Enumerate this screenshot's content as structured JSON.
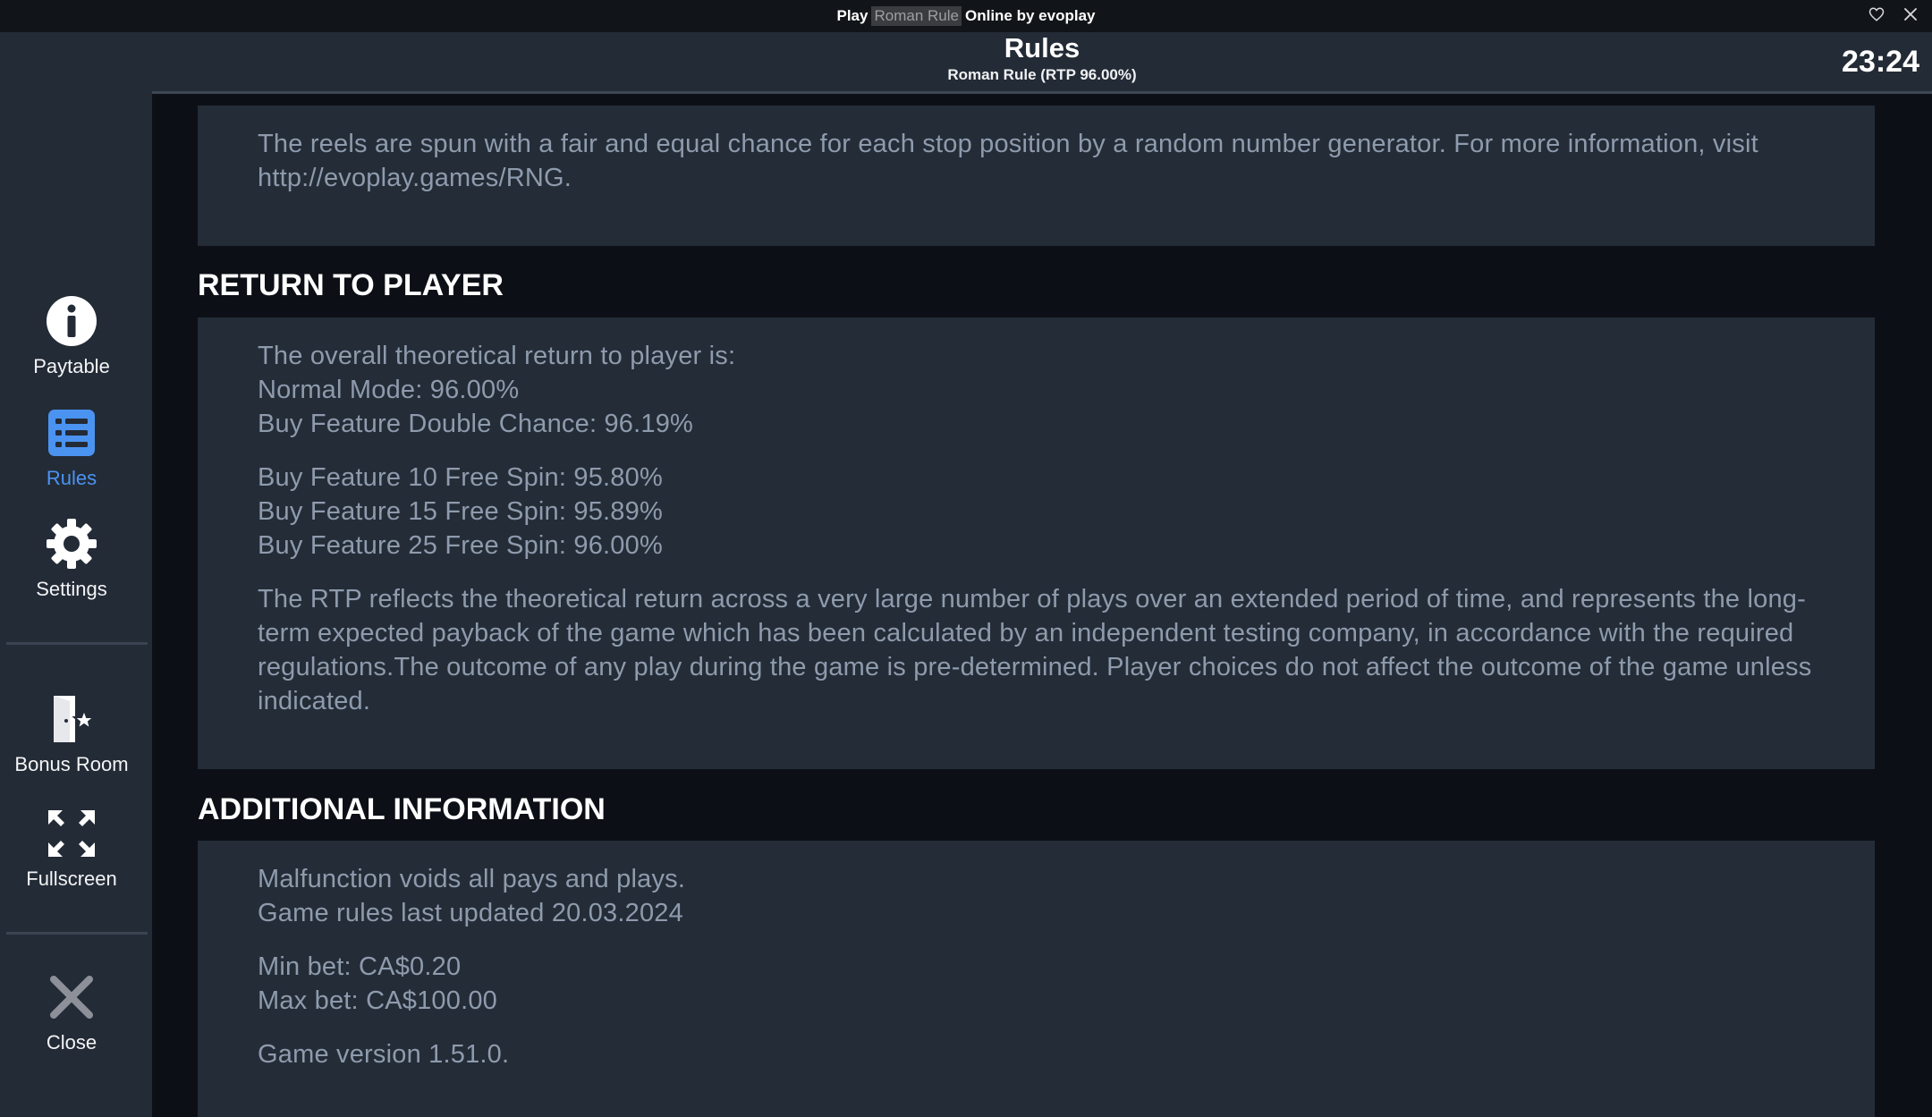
{
  "window": {
    "title_prefix": "Play",
    "title_highlight": "Roman Rule",
    "title_suffix": "Online by evoplay"
  },
  "header": {
    "title": "Rules",
    "subtitle": "Roman Rule (RTP 96.00%)",
    "clock": "23:24"
  },
  "sidebar": {
    "items": [
      {
        "label": "Paytable",
        "icon": "info-icon"
      },
      {
        "label": "Rules",
        "icon": "list-icon",
        "active": true
      },
      {
        "label": "Settings",
        "icon": "gear-icon"
      },
      {
        "label": "Bonus Room",
        "icon": "door-star-icon"
      },
      {
        "label": "Fullscreen",
        "icon": "fullscreen-icon"
      },
      {
        "label": "Close",
        "icon": "close-icon"
      }
    ]
  },
  "content": {
    "rng_text": "The reels are spun with a fair and equal chance for each stop position by a random number generator. For more information, visit http://evoplay.games/RNG.",
    "rtp": {
      "heading": "RETURN TO PLAYER",
      "lines_a": [
        "The overall theoretical return to player is:",
        "Normal Mode: 96.00%",
        "Buy Feature Double Chance: 96.19%"
      ],
      "lines_b": [
        "Buy Feature 10 Free Spin: 95.80%",
        "Buy Feature 15 Free Spin: 95.89%",
        "Buy Feature 25 Free Spin: 96.00%"
      ],
      "paragraph": "The RTP reflects the theoretical return across a very large number of plays over an extended period of time, and represents the long-term expected payback of the game which has been calculated by an independent testing company, in accordance with the required regulations.The outcome of any play during the game is pre-determined. Player choices do not affect the outcome of the game unless indicated."
    },
    "additional": {
      "heading": "ADDITIONAL INFORMATION",
      "lines_a": [
        "Malfunction voids all pays and plays.",
        "Game rules last updated 20.03.2024"
      ],
      "lines_b": [
        "Min bet: CA$0.20",
        "Max bet: CA$100.00"
      ],
      "version": "Game version 1.51.0."
    }
  },
  "colors": {
    "active_accent": "#4b93f0",
    "sidebar_bg": "#232b36",
    "panel_bg": "#242c37",
    "page_bg": "#0c1016",
    "body_text": "#8e9bad"
  }
}
